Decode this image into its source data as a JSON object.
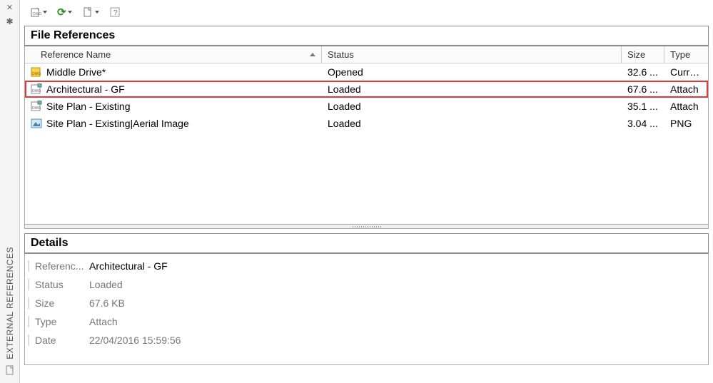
{
  "panel_title": "EXTERNAL REFERENCES",
  "sections": {
    "file_references": "File References",
    "details": "Details"
  },
  "columns": {
    "name": "Reference Name",
    "status": "Status",
    "size": "Size",
    "type": "Type"
  },
  "rows": [
    {
      "icon": "dwg-yellow",
      "name": "Middle Drive*",
      "status": "Opened",
      "size": "32.6 ...",
      "type": "Current",
      "highlight": false
    },
    {
      "icon": "dwg",
      "name": "Architectural - GF",
      "status": "Loaded",
      "size": "67.6 ...",
      "type": "Attach",
      "highlight": true
    },
    {
      "icon": "dwg",
      "name": "Site Plan - Existing",
      "status": "Loaded",
      "size": "35.1 ...",
      "type": "Attach",
      "highlight": false
    },
    {
      "icon": "image",
      "name": "Site Plan - Existing|Aerial Image",
      "status": "Loaded",
      "size": "3.04 ...",
      "type": "PNG",
      "highlight": false
    }
  ],
  "details": {
    "labels": {
      "reference": "Referenc...",
      "status": "Status",
      "size": "Size",
      "type": "Type",
      "date": "Date"
    },
    "values": {
      "reference": "Architectural - GF",
      "status": "Loaded",
      "size": "67.6 KB",
      "type": "Attach",
      "date": "22/04/2016 15:59:56"
    }
  }
}
